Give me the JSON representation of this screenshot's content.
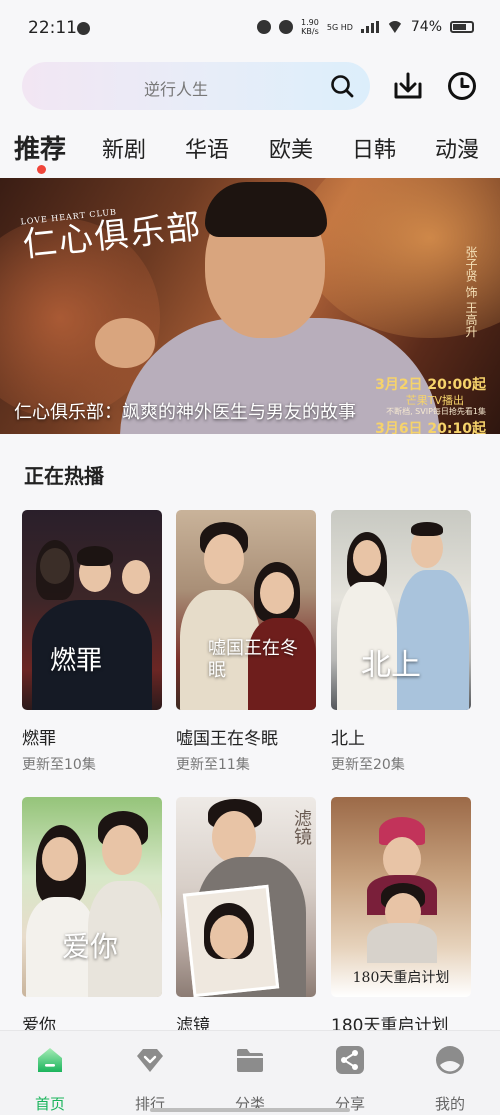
{
  "status_bar": {
    "time": "22:11",
    "net_speed": "1.90",
    "net_unit": "KB/s",
    "net_type": "5G HD",
    "battery": "74%",
    "battery_level": 0.74
  },
  "search": {
    "placeholder": "逆行人生"
  },
  "tabs": [
    {
      "label": "推荐",
      "active": true
    },
    {
      "label": "新剧"
    },
    {
      "label": "华语"
    },
    {
      "label": "欧美"
    },
    {
      "label": "日韩"
    },
    {
      "label": "动漫"
    }
  ],
  "banner": {
    "caption": "仁心俱乐部：飒爽的神外医生与男友的故事",
    "logo": "仁心俱乐部",
    "logo_en": "LOVE HEART CLUB",
    "credit": "张子贤 饰 王高升",
    "date1": "3月2日 20:00起",
    "channel": "芒果TV播出",
    "fine_print": "不断档, SVIP每日抢先看1集",
    "date2": "3月6日 20:10起"
  },
  "hot": {
    "title": "正在热播",
    "items": [
      {
        "name": "燃罪",
        "update": "更新至10集",
        "poster_text": "燃罪"
      },
      {
        "name": "嘘国王在冬眠",
        "update": "更新至11集",
        "poster_text": "嘘国王在冬眠"
      },
      {
        "name": "北上",
        "update": "更新至20集",
        "poster_text": "北上"
      },
      {
        "name": "爱你",
        "update": "",
        "poster_text": "爱你"
      },
      {
        "name": "滤镜",
        "update": "",
        "poster_text": "滤镜"
      },
      {
        "name": "180天重启计划",
        "update": "",
        "poster_text": "180天重启计划"
      }
    ]
  },
  "bottom_nav": [
    {
      "label": "首页",
      "icon": "home-icon",
      "active": true
    },
    {
      "label": "排行",
      "icon": "ranking-icon"
    },
    {
      "label": "分类",
      "icon": "category-folder-icon"
    },
    {
      "label": "分享",
      "icon": "share-icon"
    },
    {
      "label": "我的",
      "icon": "profile-icon"
    }
  ],
  "colors": {
    "accent_green": "#1bb45c",
    "tab_dot": "#f0453a",
    "banner_gold": "#f6d36b"
  }
}
